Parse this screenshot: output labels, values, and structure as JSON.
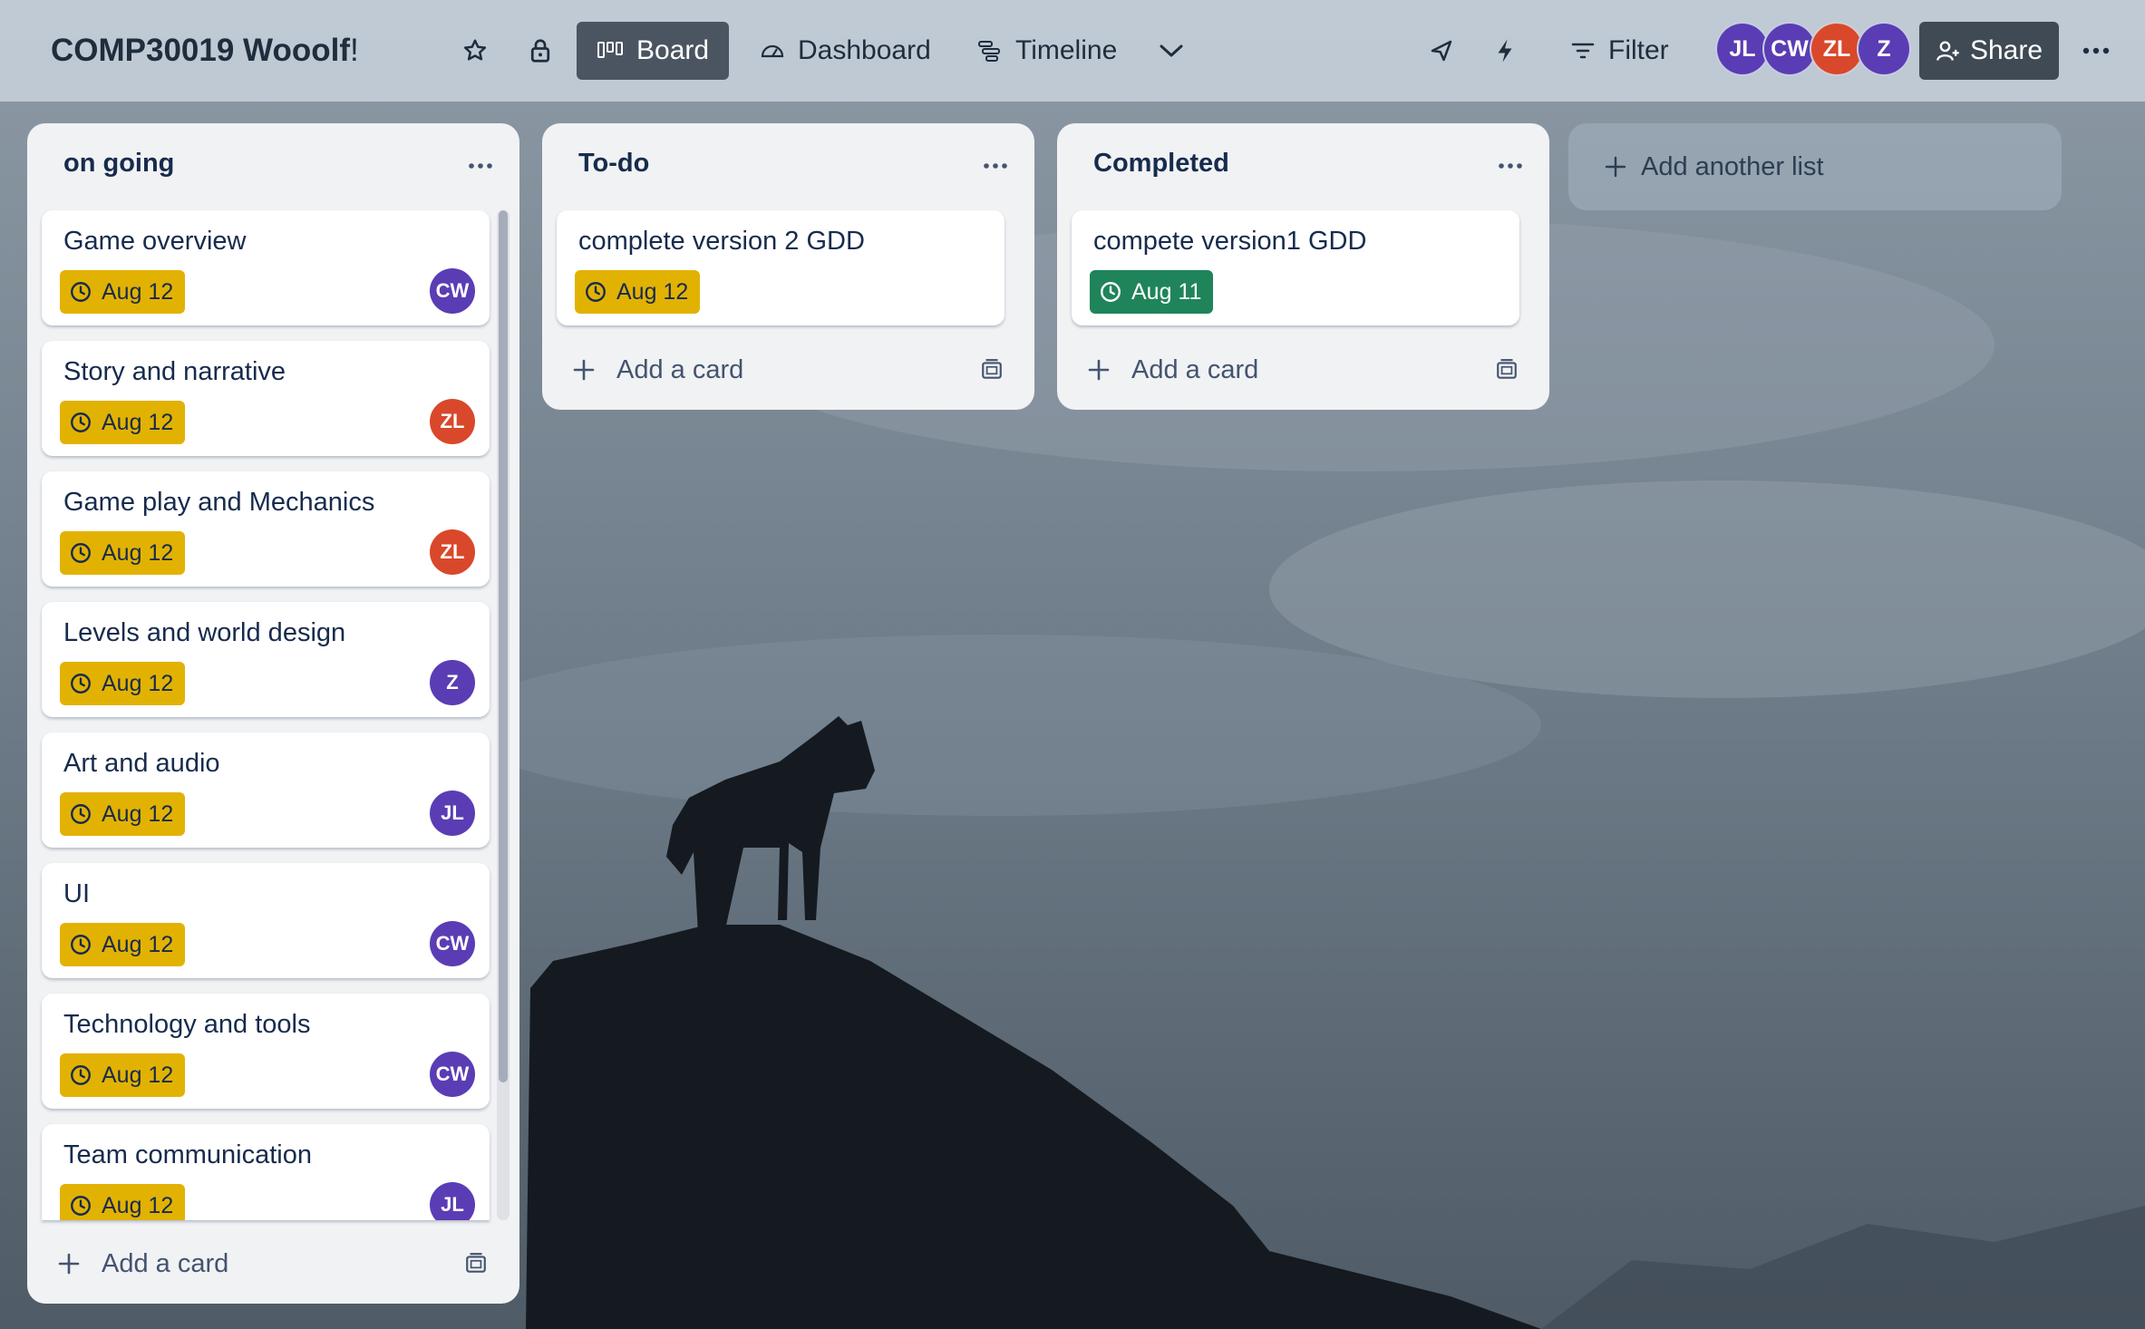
{
  "board": {
    "title": "COMP30019 Wooolf",
    "title_mark": "!",
    "views": {
      "board_label": "Board",
      "dashboard_label": "Dashboard",
      "timeline_label": "Timeline"
    },
    "filter_label": "Filter",
    "share_label": "Share",
    "members": [
      {
        "initials": "JL",
        "color": "#5a3db4"
      },
      {
        "initials": "CW",
        "color": "#5a3db4"
      },
      {
        "initials": "ZL",
        "color": "#d9482b"
      },
      {
        "initials": "Z",
        "color": "#5a3db4"
      }
    ]
  },
  "lists": [
    {
      "title": "on going",
      "cards": [
        {
          "title": "Game overview",
          "due": "Aug 12",
          "member": "CW"
        },
        {
          "title": "Story and narrative",
          "due": "Aug 12",
          "member": "ZL"
        },
        {
          "title": "Game play and Mechanics",
          "due": "Aug 12",
          "member": "ZL"
        },
        {
          "title": "Levels and world design",
          "due": "Aug 12",
          "member": "Z"
        },
        {
          "title": "Art and audio",
          "due": "Aug 12",
          "member": "JL"
        },
        {
          "title": "UI",
          "due": "Aug 12",
          "member": "CW"
        },
        {
          "title": "Technology and tools",
          "due": "Aug 12",
          "member": "CW"
        },
        {
          "title": "Team communication",
          "due": "Aug 12",
          "member": "JL"
        }
      ],
      "add_card_label": "Add a card"
    },
    {
      "title": "To-do",
      "cards": [
        {
          "title": "complete version 2 GDD",
          "due": "Aug 12"
        }
      ],
      "add_card_label": "Add a card"
    },
    {
      "title": "Completed",
      "cards": [
        {
          "title": "compete version1 GDD",
          "due": "Aug 11"
        }
      ],
      "add_card_label": "Add a card"
    }
  ],
  "add_list_label": "Add another list",
  "colors": {
    "due_soon": "#e2b203",
    "due_complete": "#1f845a",
    "avatar_purple": "#5a3db4",
    "avatar_red": "#d9482b"
  }
}
